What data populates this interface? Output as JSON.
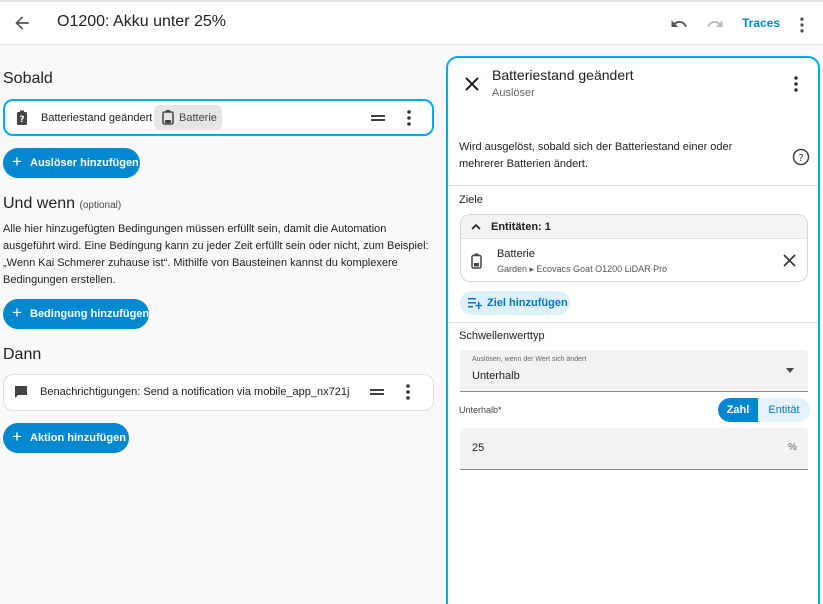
{
  "header": {
    "title": "O1200: Akku unter 25%",
    "traces_label": "Traces"
  },
  "triggers": {
    "heading": "Sobald",
    "item": {
      "label": "Batteriestand geändert",
      "chip": "Batterie"
    },
    "add_label": "Auslöser hinzufügen"
  },
  "conditions": {
    "heading": "Und wenn",
    "optional": "(optional)",
    "description": "Alle hier hinzugefügten Bedingungen müssen erfüllt sein, damit die Automation ausgeführt wird. Eine Bedingung kann zu jeder Zeit erfüllt sein oder nicht, zum Beispiel: „Wenn Kai Schmerer zuhause ist“. Mithilfe von Bausteinen kannst du komplexere Bedingungen erstellen.",
    "add_label": "Bedingung hinzufügen"
  },
  "actions": {
    "heading": "Dann",
    "item": {
      "label": "Benachrichtigungen: Send a notification via mobile_app_nx721j"
    },
    "add_label": "Aktion hinzufügen"
  },
  "panel": {
    "title": "Batteriestand geändert",
    "subtitle": "Auslöser",
    "description": "Wird ausgelöst, sobald sich der Batteriestand einer oder mehrerer Batterien ändert.",
    "targets_label": "Ziele",
    "entities_header": "Entitäten: 1",
    "entity": {
      "name": "Batterie",
      "path": "Garden ▸ Ecovacs Goat O1200 LiDAR Pro"
    },
    "add_target_label": "Ziel hinzufügen",
    "threshold_label": "Schwellenwerttyp",
    "select": {
      "label": "Auslösen, wenn der Wert sich ändert",
      "value": "Unterhalb"
    },
    "below_label": "Unterhalb*",
    "toggle": {
      "option_a": "Zahl",
      "option_b": "Entität",
      "selected": "Zahl"
    },
    "number": {
      "value": "25",
      "unit": "%"
    }
  },
  "colors": {
    "accent": "#0288d1",
    "selection_border": "#03a9f4"
  },
  "icons": [
    "back-arrow-icon",
    "undo-icon",
    "redo-icon",
    "more-vert-icon",
    "battery-unknown-icon",
    "battery-icon",
    "drag-handle-icon",
    "message-icon",
    "plus-icon",
    "close-icon",
    "help-circle-icon",
    "chevron-up-icon",
    "playlist-plus-icon",
    "dropdown-arrow-icon"
  ]
}
